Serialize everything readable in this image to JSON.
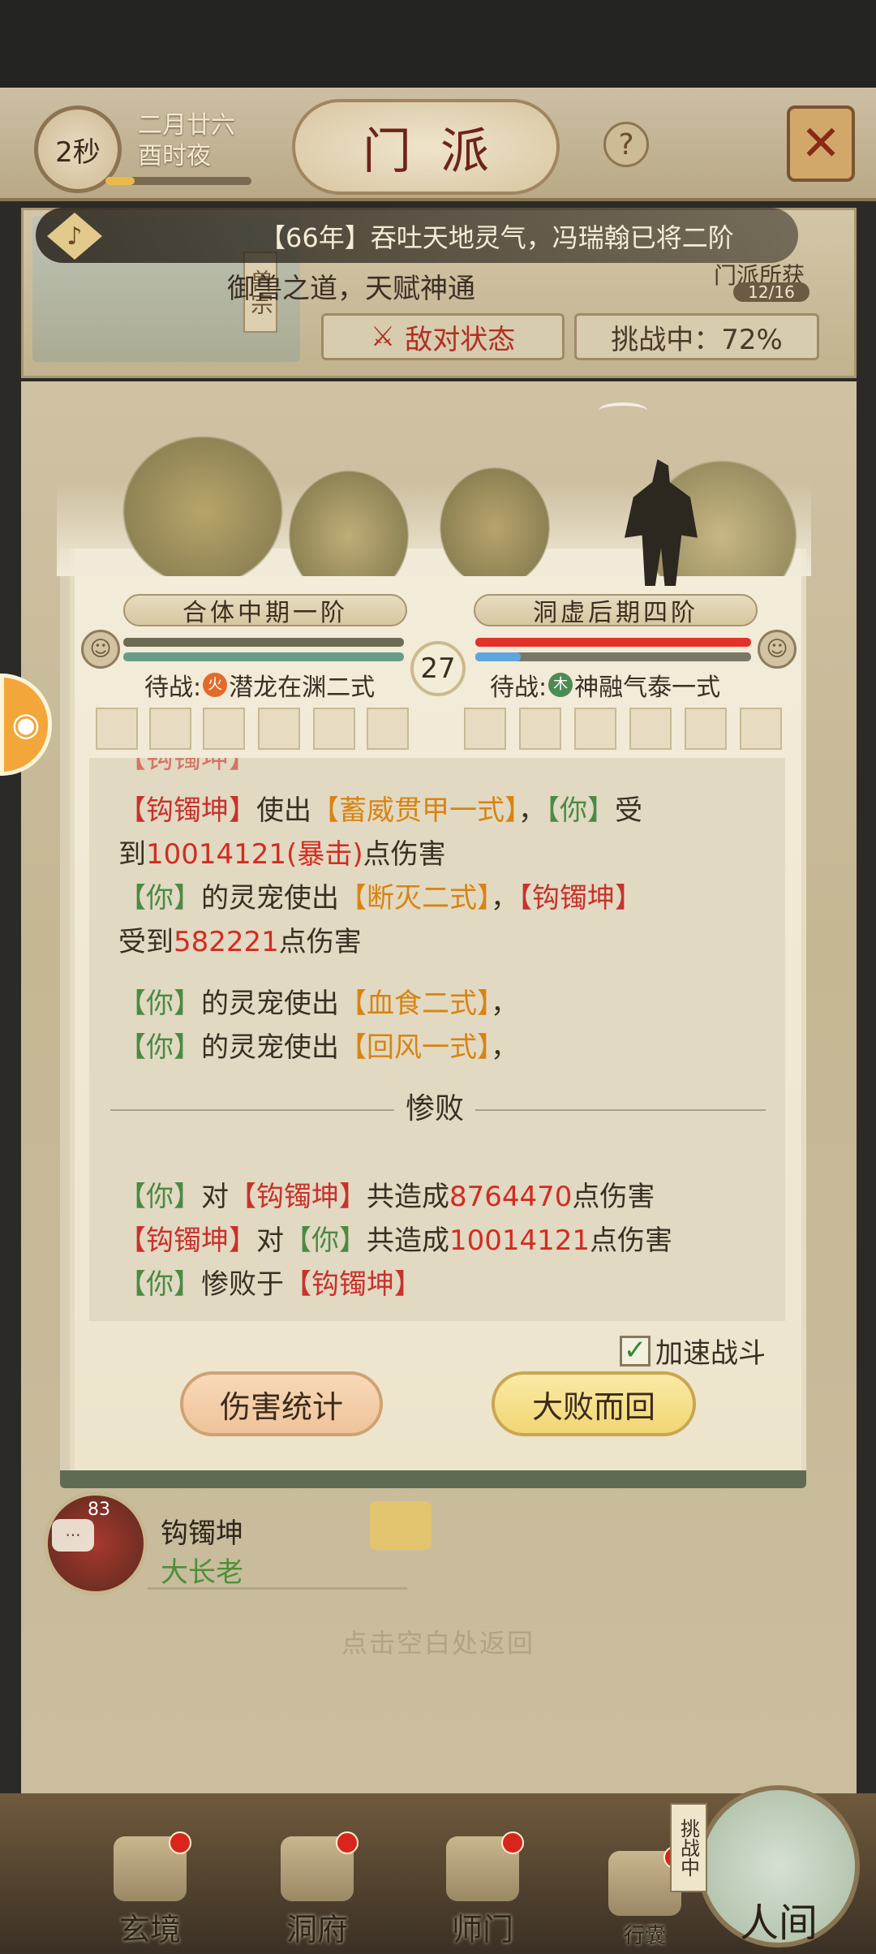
{
  "header": {
    "timer": "2秒",
    "date_line1": "二月廿六",
    "date_line2": "酉时夜",
    "title": "门派",
    "help": "?"
  },
  "sect": {
    "tag": "兽宗",
    "notice": "【66年】吞吐天地灵气，冯瑞翰已将二阶",
    "description": "御兽之道，天赋神通",
    "reward_label": "门派所获",
    "reward_count": "12/16",
    "enemy_button": "敌对状态",
    "challenge_status": "挑战中：72%"
  },
  "battle": {
    "left": {
      "rank": "合体中期一阶",
      "standby_label": "待战:",
      "element": "火",
      "skill": "潜龙在渊二式"
    },
    "right": {
      "rank": "洞虚后期四阶",
      "standby_label": "待战:",
      "element": "木",
      "skill": "神融气泰一式"
    },
    "round": "27",
    "log": {
      "line1": [
        "【钩镯坤】",
        "使出",
        "【蓄威贯甲一式】",
        "，",
        "【你】",
        "受"
      ],
      "line2": [
        "到",
        "10014121(暴击)",
        "点伤害"
      ],
      "line3": [
        "【你】",
        "的灵宠使出",
        "【断灭二式】",
        "，",
        "【钩镯坤】"
      ],
      "line4": [
        "受到",
        "582221",
        "点伤害"
      ],
      "line5": [
        "【你】",
        "的灵宠使出",
        "【血食二式】",
        "，"
      ],
      "line6": [
        "【你】",
        "的灵宠使出",
        "【回风一式】",
        "，"
      ],
      "result": "惨败",
      "sum1": [
        "【你】",
        "对",
        "【钩镯坤】",
        "共造成",
        "8764470",
        "点伤害"
      ],
      "sum2": [
        "【钩镯坤】",
        "对",
        "【你】",
        "共造成",
        "10014121",
        "点伤害"
      ],
      "sum3": [
        "【你】",
        "惨败于",
        "【钩镯坤】"
      ]
    },
    "speed_label": "加速战斗",
    "speed_checked": true,
    "stats_button": "伤害统计",
    "retreat_button": "大败而回"
  },
  "elder": {
    "level": "83",
    "name": "钩镯坤",
    "title": "大长老"
  },
  "tap_hint": "点击空白处返回",
  "nav": {
    "items": [
      "玄境",
      "洞府",
      "师门",
      "行囊"
    ],
    "challenge_tag": "挑战中",
    "world": "人间"
  },
  "colors": {
    "player": "#4b8a45",
    "enemy": "#c8322c",
    "skill": "#d88412",
    "damage": "#d22c22"
  }
}
